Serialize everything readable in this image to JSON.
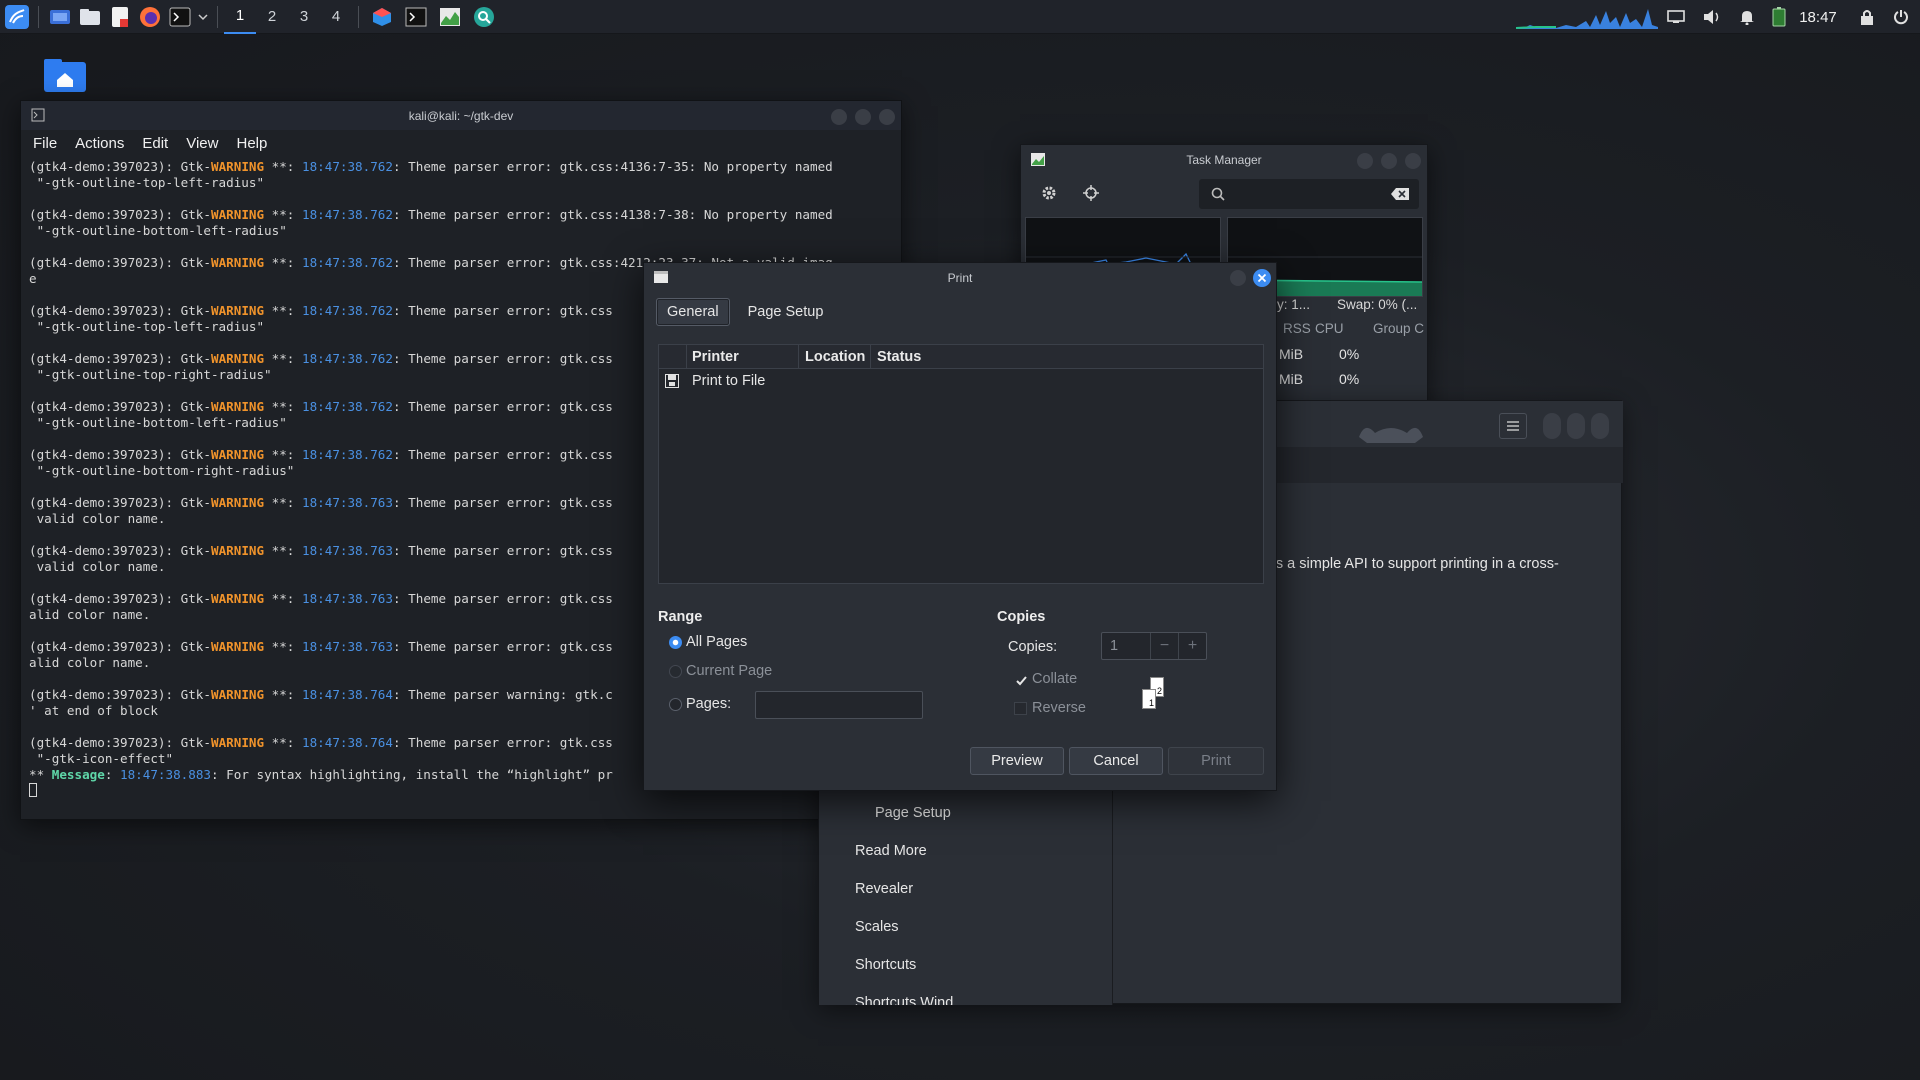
{
  "panel": {
    "workspaces": [
      "1",
      "2",
      "3",
      "4"
    ],
    "active_workspace": "1",
    "clock": "18:47",
    "app_icons": [
      "kali-menu-icon",
      "show-desktop-icon",
      "file-manager-icon",
      "text-editor-icon",
      "firefox-icon",
      "terminal-icon",
      "chevron-down-icon"
    ],
    "running_icons": [
      "app-cube-icon",
      "terminal-window-icon",
      "task-manager-icon",
      "search-icon"
    ],
    "tray_icons": [
      "display-icon",
      "volume-icon",
      "notification-bell-icon",
      "battery-icon",
      "lock-icon",
      "power-icon"
    ]
  },
  "desktop": {
    "home_icon": "home-folder-icon"
  },
  "terminal": {
    "title": "kali@kali: ~/gtk-dev",
    "menu": [
      "File",
      "Actions",
      "Edit",
      "View",
      "Help"
    ],
    "log": [
      {
        "pre": "(gtk4-demo:397023): Gtk-",
        "level": "WARNING",
        "mid": " **: ",
        "time": "18:47:38.762",
        "msg": ": Theme parser error: gtk.css:4136:7-35: No property named",
        "cont": " \"-gtk-outline-top-left-radius\""
      },
      {
        "pre": "(gtk4-demo:397023): Gtk-",
        "level": "WARNING",
        "mid": " **: ",
        "time": "18:47:38.762",
        "msg": ": Theme parser error: gtk.css:4138:7-38: No property named",
        "cont": " \"-gtk-outline-bottom-left-radius\""
      },
      {
        "pre": "(gtk4-demo:397023): Gtk-",
        "level": "WARNING",
        "mid": " **: ",
        "time": "18:47:38.762",
        "msg": ": Theme parser error: gtk.css:4212:23-37: Not a valid imag",
        "cont": "e"
      },
      {
        "pre": "(gtk4-demo:397023): Gtk-",
        "level": "WARNING",
        "mid": " **: ",
        "time": "18:47:38.762",
        "msg": ": Theme parser error: gtk.css",
        "cont": " \"-gtk-outline-top-left-radius\""
      },
      {
        "pre": "(gtk4-demo:397023): Gtk-",
        "level": "WARNING",
        "mid": " **: ",
        "time": "18:47:38.762",
        "msg": ": Theme parser error: gtk.css",
        "cont": " \"-gtk-outline-top-right-radius\""
      },
      {
        "pre": "(gtk4-demo:397023): Gtk-",
        "level": "WARNING",
        "mid": " **: ",
        "time": "18:47:38.762",
        "msg": ": Theme parser error: gtk.css",
        "cont": " \"-gtk-outline-bottom-left-radius\""
      },
      {
        "pre": "(gtk4-demo:397023): Gtk-",
        "level": "WARNING",
        "mid": " **: ",
        "time": "18:47:38.762",
        "msg": ": Theme parser error: gtk.css",
        "cont": " \"-gtk-outline-bottom-right-radius\""
      },
      {
        "pre": "(gtk4-demo:397023): Gtk-",
        "level": "WARNING",
        "mid": " **: ",
        "time": "18:47:38.763",
        "msg": ": Theme parser error: gtk.css",
        "cont": " valid color name."
      },
      {
        "pre": "(gtk4-demo:397023): Gtk-",
        "level": "WARNING",
        "mid": " **: ",
        "time": "18:47:38.763",
        "msg": ": Theme parser error: gtk.css",
        "cont": " valid color name."
      },
      {
        "pre": "(gtk4-demo:397023): Gtk-",
        "level": "WARNING",
        "mid": " **: ",
        "time": "18:47:38.763",
        "msg": ": Theme parser error: gtk.css",
        "cont": "alid color name."
      },
      {
        "pre": "(gtk4-demo:397023): Gtk-",
        "level": "WARNING",
        "mid": " **: ",
        "time": "18:47:38.763",
        "msg": ": Theme parser error: gtk.css",
        "cont": "alid color name."
      },
      {
        "pre": "(gtk4-demo:397023): Gtk-",
        "level": "WARNING",
        "mid": " **: ",
        "time": "18:47:38.764",
        "msg": ": Theme parser warning: gtk.c",
        "cont": "' at end of block"
      },
      {
        "pre": "(gtk4-demo:397023): Gtk-",
        "level": "WARNING",
        "mid": " **: ",
        "time": "18:47:38.764",
        "msg": ": Theme parser error: gtk.css",
        "cont": " \"-gtk-icon-effect\""
      }
    ],
    "message": {
      "pre": "** ",
      "label": "Message",
      "sep": ": ",
      "time": "18:47:38.883",
      "text": ": For syntax highlighting, install the “highlight” pr"
    }
  },
  "taskmgr": {
    "title": "Task Manager",
    "status_left": "y: 1...",
    "status_right": "Swap: 0% (...",
    "columns": [
      "RSS",
      "CPU",
      "Group C"
    ],
    "rows": [
      {
        "rss": "MiB",
        "cpu": "0%"
      },
      {
        "rss": "MiB",
        "cpu": "0%"
      }
    ],
    "accent": "#27c28a"
  },
  "demo": {
    "description": "ers a simple API to support printing in a cross-",
    "sidebar": [
      "Page Setup",
      "Read More",
      "Revealer",
      "Scales",
      "Shortcuts",
      "Shortcuts Wind"
    ]
  },
  "print": {
    "title": "Print",
    "tabs": [
      "General",
      "Page Setup"
    ],
    "columns": [
      "Printer",
      "Location",
      "Status"
    ],
    "printers": [
      {
        "name": "Print to File"
      }
    ],
    "range": {
      "title": "Range",
      "all_pages": "All Pages",
      "current_page": "Current Page",
      "pages": "Pages:",
      "pages_value": ""
    },
    "copies": {
      "title": "Copies",
      "label": "Copies:",
      "value": "1",
      "collate": "Collate",
      "reverse": "Reverse",
      "page_front": "2",
      "page_back": "1"
    },
    "buttons": {
      "preview": "Preview",
      "cancel": "Cancel",
      "print": "Print"
    },
    "accent": "#3c8cf2"
  }
}
